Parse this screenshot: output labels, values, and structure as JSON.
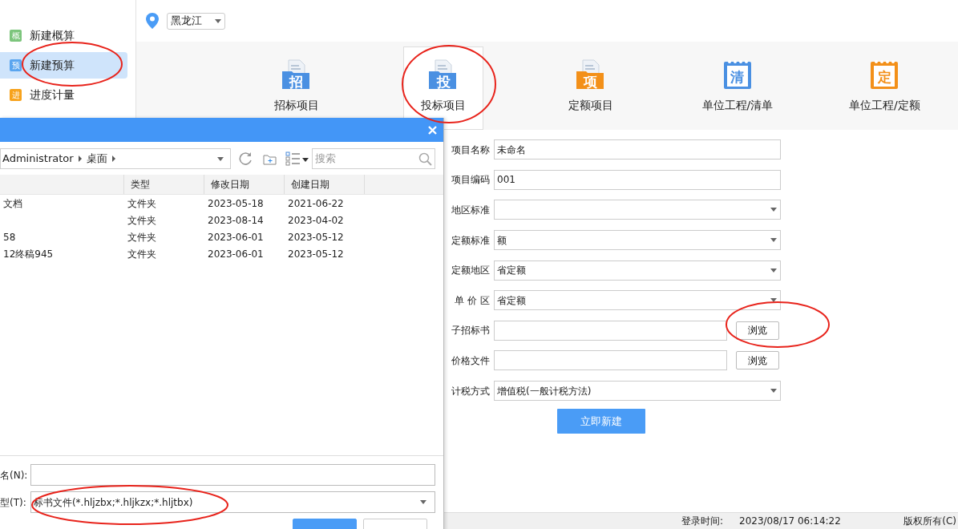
{
  "sidebar": {
    "items": [
      {
        "icon_text": "概",
        "label": "新建概算",
        "color": "#7cc57c",
        "selected": false
      },
      {
        "icon_text": "预",
        "label": "新建预算",
        "color": "#5aa5ef",
        "selected": true
      },
      {
        "icon_text": "进",
        "label": "进度计量",
        "color": "#f7a21b",
        "selected": false
      }
    ]
  },
  "region_select": {
    "value": "黑龙江"
  },
  "project_types": [
    {
      "icon_text": "招",
      "label": "招标项目",
      "kind": "folder",
      "color": "#4a90e2",
      "selected": false
    },
    {
      "icon_text": "投",
      "label": "投标项目",
      "kind": "folder",
      "color": "#4a90e2",
      "selected": true
    },
    {
      "icon_text": "项",
      "label": "定额项目",
      "kind": "folder",
      "color": "#f39019",
      "selected": false
    },
    {
      "icon_text": "清",
      "label": "单位工程/清单",
      "kind": "notebook",
      "color": "#4a90e2",
      "selected": false
    },
    {
      "icon_text": "定",
      "label": "单位工程/定额",
      "kind": "notebook",
      "color": "#f39019",
      "selected": false
    }
  ],
  "form": {
    "fields": [
      {
        "label": "项目名称",
        "kind": "text",
        "value": "未命名"
      },
      {
        "label": "项目编码",
        "kind": "text",
        "value": "001"
      },
      {
        "label": "地区标准",
        "kind": "select"
      },
      {
        "label": "定额标准",
        "kind": "select",
        "value": "额"
      },
      {
        "label": "定额地区",
        "kind": "select",
        "value": "省定额"
      },
      {
        "label": "单 价 区",
        "kind": "select",
        "value": "省定额"
      },
      {
        "label": "子招标书",
        "kind": "file",
        "button": "浏览"
      },
      {
        "label": "价格文件",
        "kind": "file",
        "button": "浏览"
      },
      {
        "label": "计税方式",
        "kind": "select",
        "value": "增值税(一般计税方法)"
      }
    ],
    "submit": "立即新建"
  },
  "file_dialog": {
    "path": [
      "Administrator",
      "桌面"
    ],
    "search_placeholder": "搜索",
    "columns": [
      "",
      "类型",
      "修改日期",
      "创建日期"
    ],
    "rows": [
      [
        "文档",
        "文件夹",
        "2023-05-18",
        "2021-06-22"
      ],
      [
        null,
        "文件夹",
        "2023-08-14",
        "2023-04-02"
      ],
      [
        "58",
        "文件夹",
        "2023-06-01",
        "2023-05-12"
      ],
      [
        "12终稿945",
        "文件夹",
        "2023-06-01",
        "2023-05-12"
      ]
    ],
    "filename_label": "名(N):",
    "filetype_label": "型(T):",
    "filetype_value": "标书文件(*.hljzbx;*.hljkzx;*.hljtbx)"
  },
  "status_bar": {
    "login_label": "登录时间:",
    "login_time": "2023/08/17 06:14:22",
    "copyright": "版权所有(C)"
  }
}
